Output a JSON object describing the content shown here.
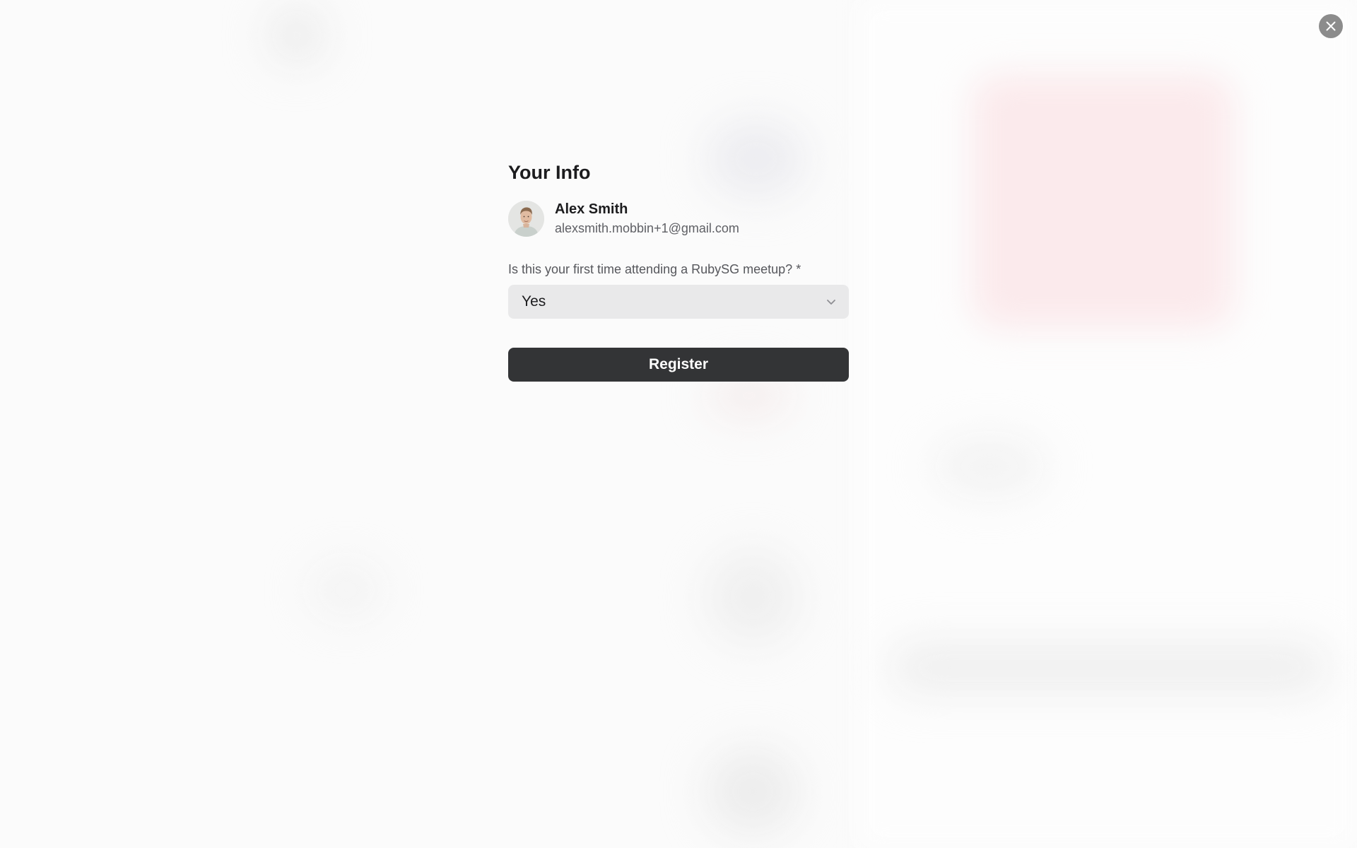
{
  "modal": {
    "close_icon": "close-icon"
  },
  "form": {
    "title": "Your Info",
    "user": {
      "name": "Alex Smith",
      "email": "alexsmith.mobbin+1@gmail.com",
      "avatar_icon": "avatar"
    },
    "question": {
      "label": "Is this your first time attending a RubySG meetup? *",
      "selected_value": "Yes",
      "dropdown_icon": "chevron-down-icon"
    },
    "submit_label": "Register"
  },
  "colors": {
    "button_bg": "#333436",
    "select_bg": "#e9e9ea",
    "close_bg": "#8c8c8c",
    "page_bg": "#fbfbfb"
  }
}
